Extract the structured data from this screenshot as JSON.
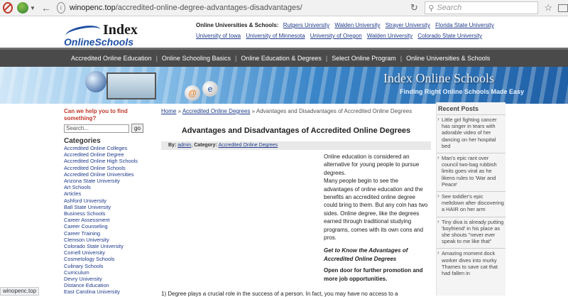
{
  "browser": {
    "url_host": "winopenc.top",
    "url_path": "/accredited-online-degree-advantages-disadvantages/",
    "search_placeholder": "Search",
    "status_url": "winopenc.top"
  },
  "header": {
    "logo_line1": "Index",
    "logo_line2": "OnlineSchools",
    "links_label": "Online Universities & Schools:",
    "links": [
      "Rutgers University",
      "Walden University",
      "Strayer University",
      "Florida State University",
      "University of Iowa",
      "University of Minnesota",
      "University of Oregon",
      "Walden University",
      "Colorado State University"
    ]
  },
  "nav": [
    "Accredited Online Education",
    "Online Schooling Basics",
    "Online Education & Degrees",
    "Select Online Program",
    "Online Universities & Schools"
  ],
  "banner": {
    "title": "Index Online Schools",
    "subtitle": "Finding Right Online Schools Made Easy"
  },
  "left": {
    "help": "Can we help you to find something?",
    "search_placeholder": "Search...",
    "go": "go",
    "categories_title": "Categories",
    "categories": [
      "Accredited Online Colleges",
      "Accredited Online Degree",
      "Accredited Online High Schools",
      "Accredited Online Schools",
      "Accredited Online Universities",
      "Arizona State University",
      "Art Schools",
      "Articles",
      "Ashford University",
      "Ball State University",
      "Business Schools",
      "Career Assessment",
      "Career Counseling",
      "Career Training",
      "Clemson University",
      "Colorado State University",
      "Cornell University",
      "Cosmetology Schools",
      "Culinary Schools",
      "Curriculum",
      "Devry University",
      "Distance Education",
      "East Carolina University"
    ]
  },
  "main": {
    "crumb_home": "Home",
    "crumb_sep": "»",
    "crumb_cat": "Accredited Online Degrees",
    "crumb_current": "Advantages and Disadvantages of Accredited Online Degrees",
    "title": "Advantages and Disadvantages of Accredited Online Degrees",
    "by_label": "By:",
    "author": "admin",
    "cat_label": "Category:",
    "category": "Accredited Online Degrees",
    "para1": "Online education is considered an alternative for young people to pursue degrees.",
    "para2": "Many people begin to see the advantages of online education and the benefits an accredited online degree could bring to them. But any coin has two sides. Online degree, like the degrees earned through traditional studying programs, comes with its own cons and pros.",
    "subhead": "Get to Know the Advantages of Accredited Online Degrees",
    "strong": "Open door for further promotion and more job opportunities.",
    "bottom": "1) Degree plays a crucial role in the success of a person. In fact, you may have no access to a"
  },
  "right": {
    "title": "Recent Posts",
    "posts": [
      "Little girl fighting cancer has singer in tears with adorable video of her dancing on her hospital bed",
      "Man's epic rant over council two-bag rubbish limits goes viral as he likens rules to 'War and Peace'",
      "See toddler's epic meltdown after discovering a HAIR on her arm",
      "Tiny diva is already putting 'boyfriend' in his place as she shouts \"never ever speak to me like that\"",
      "Amazing moment dock worker dives into murky Thames to save cat that had fallen in"
    ]
  }
}
